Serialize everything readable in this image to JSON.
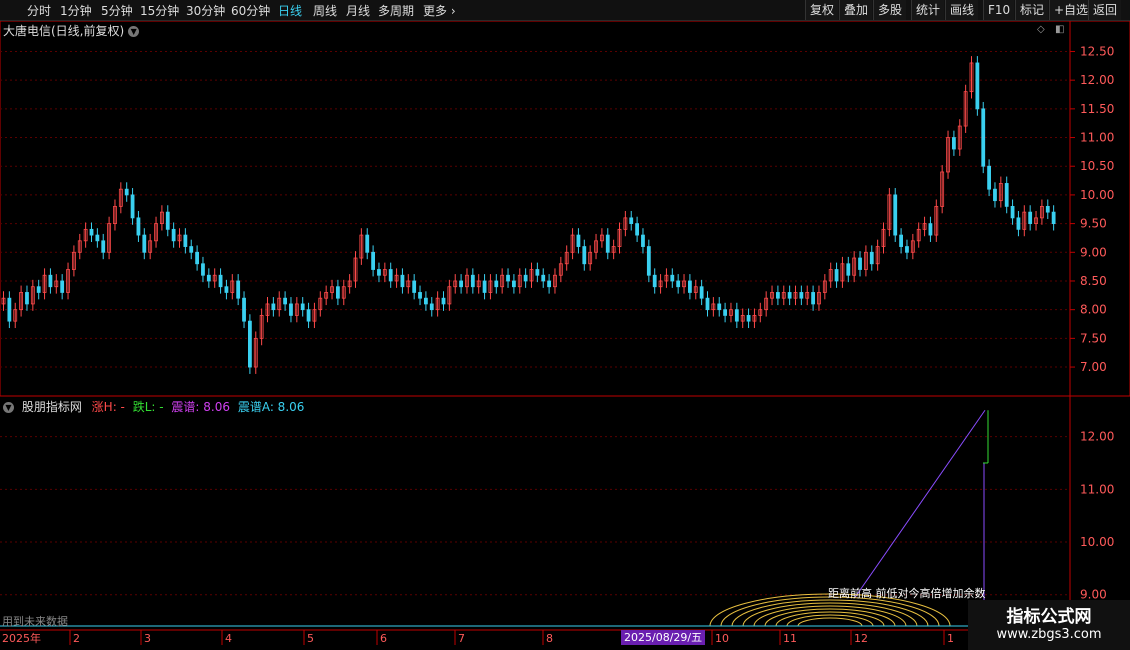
{
  "toolbar": {
    "periods": [
      "分时",
      "1分钟",
      "5分钟",
      "15分钟",
      "30分钟",
      "60分钟",
      "日线",
      "周线",
      "月线",
      "多周期",
      "更多"
    ],
    "active_period": "日线",
    "buttons": [
      "复权",
      "叠加",
      "多股",
      "统计",
      "画线",
      "F10",
      "标记",
      "+自选",
      "返回"
    ]
  },
  "main_title": "大唐电信(日线,前复权)",
  "indicator": {
    "name": "股朋指标网",
    "up_label": "涨H: -",
    "down_label": "跌L: -",
    "zp_label": "震谱: 8.06",
    "zpa_label": "震谱A: 8.06",
    "formula_caption": "距离前高 前低对今高倍增加余数",
    "future_note": "用到未来数据"
  },
  "x_axis": {
    "year_label": "2025年",
    "month_labels": [
      "2",
      "3",
      "4",
      "5",
      "6",
      "7",
      "8",
      "10",
      "11",
      "12",
      "1"
    ],
    "cursor_date": "2025/08/29/五"
  },
  "watermark": {
    "title": "指标公式网",
    "url": "www.zbgs3.com"
  },
  "colors": {
    "up": "#ff4a4a",
    "down": "#3ad0f0",
    "grid": "#5a0000",
    "axis": "#c00000",
    "line": "#8a4dff",
    "green": "#33dd33"
  },
  "chart_data": {
    "type": "candlestick",
    "y_ticks_main": [
      "12.50",
      "12.00",
      "11.50",
      "11.00",
      "10.50",
      "10.00",
      "9.50",
      "9.00",
      "8.50",
      "8.00",
      "7.50",
      "7.00"
    ],
    "y_ticks_indicator": [
      "12.00",
      "11.00",
      "10.00",
      "9.00"
    ],
    "ylim_main": [
      6.6,
      12.7
    ],
    "ylim_indicator": [
      8.9,
      12.6
    ],
    "closes": [
      8.2,
      7.8,
      8.0,
      8.3,
      8.1,
      8.4,
      8.3,
      8.6,
      8.4,
      8.5,
      8.3,
      8.7,
      9.0,
      9.2,
      9.4,
      9.3,
      9.2,
      9.0,
      9.5,
      9.8,
      10.1,
      10.0,
      9.6,
      9.3,
      9.0,
      9.2,
      9.5,
      9.7,
      9.4,
      9.2,
      9.3,
      9.1,
      9.0,
      8.8,
      8.6,
      8.5,
      8.6,
      8.4,
      8.3,
      8.5,
      8.2,
      7.8,
      7.0,
      7.5,
      7.9,
      8.1,
      8.0,
      8.2,
      8.1,
      7.9,
      8.1,
      8.0,
      7.8,
      8.0,
      8.2,
      8.3,
      8.4,
      8.2,
      8.4,
      8.5,
      8.9,
      9.3,
      9.0,
      8.7,
      8.6,
      8.7,
      8.5,
      8.6,
      8.4,
      8.5,
      8.3,
      8.2,
      8.1,
      8.0,
      8.2,
      8.1,
      8.4,
      8.5,
      8.4,
      8.6,
      8.4,
      8.5,
      8.3,
      8.5,
      8.4,
      8.6,
      8.5,
      8.4,
      8.6,
      8.5,
      8.7,
      8.6,
      8.5,
      8.4,
      8.6,
      8.8,
      9.0,
      9.3,
      9.1,
      8.8,
      9.0,
      9.2,
      9.3,
      9.0,
      9.1,
      9.4,
      9.6,
      9.5,
      9.3,
      9.1,
      8.6,
      8.4,
      8.5,
      8.6,
      8.5,
      8.4,
      8.5,
      8.3,
      8.4,
      8.2,
      8.0,
      8.1,
      8.0,
      7.9,
      8.0,
      7.8,
      7.9,
      7.8,
      7.9,
      8.0,
      8.2,
      8.3,
      8.2,
      8.3,
      8.2,
      8.3,
      8.2,
      8.3,
      8.1,
      8.3,
      8.5,
      8.7,
      8.5,
      8.8,
      8.6,
      8.9,
      8.7,
      9.0,
      8.8,
      9.1,
      9.4,
      10.0,
      9.3,
      9.1,
      9.0,
      9.2,
      9.4,
      9.5,
      9.3,
      9.8,
      10.4,
      11.0,
      10.8,
      11.2,
      11.8,
      12.3,
      11.5,
      10.5,
      10.1,
      9.9,
      10.2,
      9.8,
      9.6,
      9.4,
      9.7,
      9.5,
      9.6,
      9.8,
      9.7,
      9.5
    ]
  }
}
